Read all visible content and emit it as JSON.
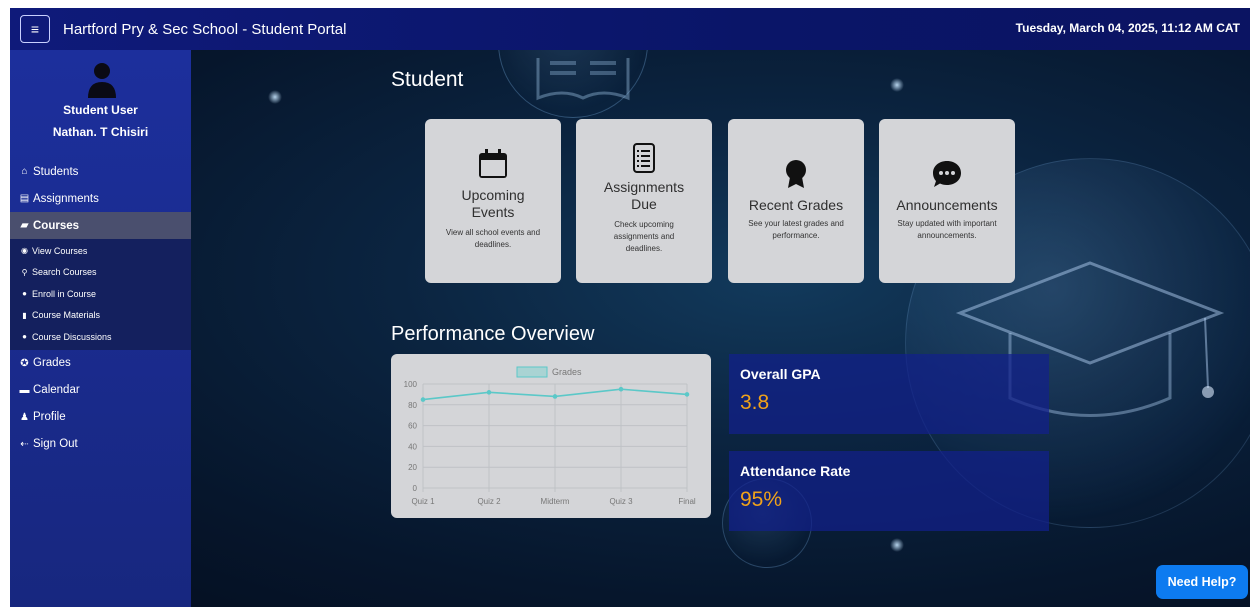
{
  "header": {
    "menu_icon": "hamburger-icon",
    "title": "Hartford Pry & Sec School - Student Portal",
    "datetime": "Tuesday, March 04, 2025, 11:12 AM CAT"
  },
  "user": {
    "role": "Student User",
    "name": "Nathan. T Chisiri",
    "avatar_icon": "user-icon"
  },
  "sidebar": {
    "items": [
      {
        "label": "Students",
        "icon": "home-icon",
        "active": false
      },
      {
        "label": "Assignments",
        "icon": "clipboard-icon",
        "active": false
      },
      {
        "label": "Courses",
        "icon": "book-icon",
        "active": true
      }
    ],
    "sub_items": [
      {
        "label": "View Courses",
        "icon": "eye-icon"
      },
      {
        "label": "Search Courses",
        "icon": "search-icon"
      },
      {
        "label": "Enroll in Course",
        "icon": "plus-circle-icon"
      },
      {
        "label": "Course Materials",
        "icon": "file-icon"
      },
      {
        "label": "Course Discussions",
        "icon": "chat-icon"
      }
    ],
    "bottom_items": [
      {
        "label": "Grades",
        "icon": "award-icon"
      },
      {
        "label": "Calendar",
        "icon": "calendar-icon"
      },
      {
        "label": "Profile",
        "icon": "person-icon"
      },
      {
        "label": "Sign Out",
        "icon": "sign-out-icon"
      }
    ]
  },
  "main": {
    "title": "Student",
    "cards": [
      {
        "title": "Upcoming Events",
        "description": "View all school events and deadlines.",
        "icon": "calendar-icon"
      },
      {
        "title": "Assignments Due",
        "description": "Check upcoming assignments and deadlines.",
        "icon": "list-icon"
      },
      {
        "title": "Recent Grades",
        "description": "See your latest grades and performance.",
        "icon": "award-icon"
      },
      {
        "title": "Announcements",
        "description": "Stay updated with important announcements.",
        "icon": "chat-dots-icon"
      }
    ],
    "performance_title": "Performance Overview",
    "stats": [
      {
        "label": "Overall GPA",
        "value": "3.8"
      },
      {
        "label": "Attendance Rate",
        "value": "95%"
      }
    ],
    "help_label": "Need Help?"
  },
  "colors": {
    "topbar": "#0f1a7a",
    "sidebar": "#1c2f9c",
    "active_item": "#4a4f6e",
    "accent_value": "#f0a21a",
    "help_button": "#0d7bf0",
    "line": "#5bc8c8"
  },
  "chart_data": {
    "type": "line",
    "categories": [
      "Quiz 1",
      "Quiz 2",
      "Midterm",
      "Quiz 3",
      "Final"
    ],
    "series": [
      {
        "name": "Grades",
        "values": [
          85,
          92,
          88,
          95,
          90
        ]
      }
    ],
    "ylim": [
      0,
      100
    ],
    "yticks": [
      "0",
      "20",
      "40",
      "60",
      "80",
      "100"
    ],
    "grid": true,
    "legend": "top"
  }
}
